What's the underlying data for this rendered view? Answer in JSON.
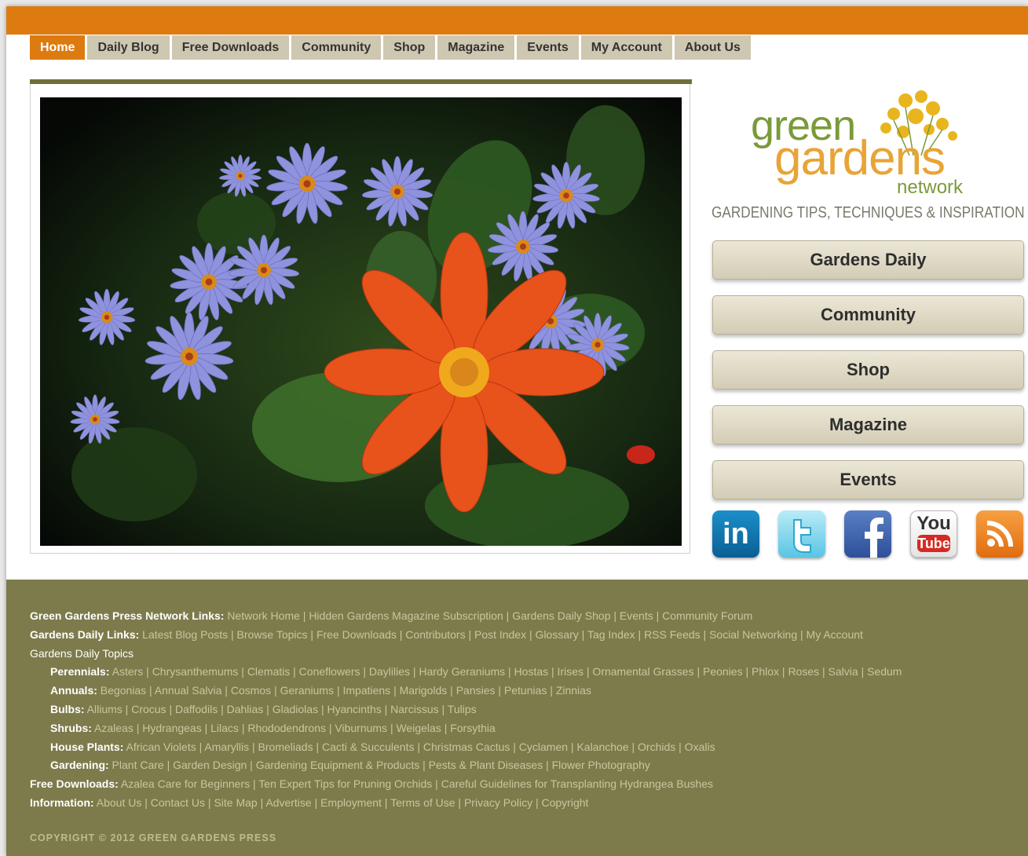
{
  "nav": {
    "items": [
      "Home",
      "Daily Blog",
      "Free Downloads",
      "Community",
      "Shop",
      "Magazine",
      "Events",
      "My Account",
      "About Us"
    ],
    "active": "Home"
  },
  "logo": {
    "green": "green",
    "gardens": "gardens",
    "network": "network"
  },
  "tagline": "GARDENING TIPS, TECHNIQUES & INSPIRATION",
  "side_buttons": [
    "Gardens Daily",
    "Community",
    "Shop",
    "Magazine",
    "Events"
  ],
  "social": {
    "linkedin": "in",
    "youtube_top": "You",
    "youtube_bottom": "Tube",
    "icons": [
      "linkedin-icon",
      "twitter-icon",
      "facebook-icon",
      "youtube-icon",
      "rss-icon"
    ]
  },
  "colors": {
    "orange": "#dd7b11",
    "olive": "#7d7b4b",
    "tab": "#cec7b1",
    "link": "#c8c6a0"
  },
  "footer": {
    "network": {
      "label": "Green Gardens Press Network Links:",
      "text": " Network Home | Hidden Gardens Magazine Subscription | Gardens Daily Shop | Events | Community Forum"
    },
    "daily": {
      "label": "Gardens Daily Links:",
      "text": " Latest Blog Posts | Browse Topics | Free Downloads | Contributors | Post Index | Glossary | Tag Index | RSS Feeds | Social Networking | My Account"
    },
    "topics": "Gardens Daily Topics",
    "perennials": {
      "label": "Perennials:",
      "text": " Asters | Chrysanthemums | Clematis | Coneflowers | Daylilies | Hardy Geraniums | Hostas | Irises | Ornamental Grasses | Peonies | Phlox | Roses | Salvia | Sedum"
    },
    "annuals": {
      "label": "Annuals:",
      "text": " Begonias | Annual Salvia | Cosmos | Geraniums | Impatiens | Marigolds | Pansies | Petunias | Zinnias"
    },
    "bulbs": {
      "label": "Bulbs:",
      "text": " Alliums | Crocus | Daffodils | Dahlias | Gladiolas | Hyancinths | Narcissus | Tulips"
    },
    "shrubs": {
      "label": "Shrubs:",
      "text": " Azaleas | Hydrangeas | Lilacs | Rhododendrons | Viburnums | Weigelas | Forsythia"
    },
    "house": {
      "label": "House Plants:",
      "text": " African Violets | Amaryllis | Bromeliads | Cacti & Succulents | Christmas Cactus | Cyclamen | Kalanchoe | Orchids | Oxalis"
    },
    "gardening": {
      "label": "Gardening:",
      "text": " Plant Care | Garden Design | Gardening Equipment & Products | Pests & Plant Diseases | Flower Photography"
    },
    "downloads": {
      "label": "Free Downloads:",
      "text": " Azalea Care for Beginners | Ten Expert Tips for Pruning Orchids | Careful Guidelines for Transplanting Hydrangea Bushes"
    },
    "info": {
      "label": "Information:",
      "text": " About Us | Contact Us | Site Map | Advertise | Employment | Terms of Use | Privacy Policy | Copyright"
    },
    "copyright": "COPYRIGHT © 2012 GREEN GARDENS PRESS"
  }
}
